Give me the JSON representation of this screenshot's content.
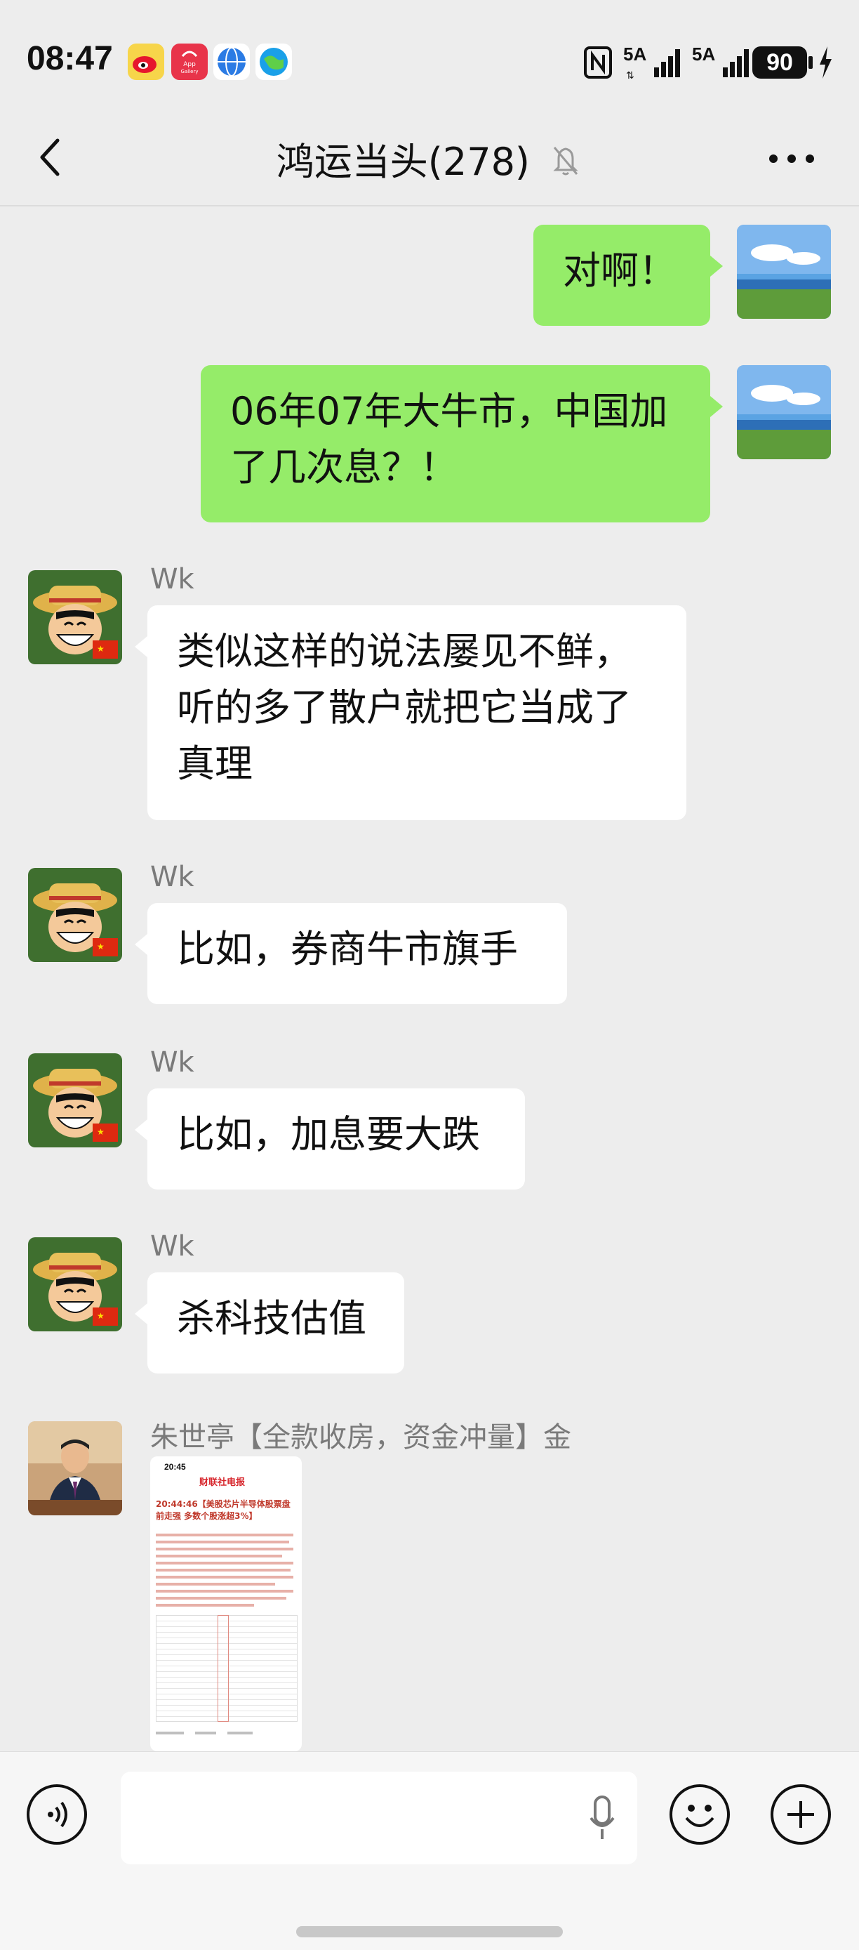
{
  "status_bar": {
    "time": "08:47",
    "signal_1": "5A",
    "signal_2": "5A",
    "battery": "90",
    "app_icons": [
      "weibo-icon",
      "app-gallery-icon",
      "browser-icon",
      "earth-icon"
    ]
  },
  "header": {
    "title": "鸿运当头(278)",
    "back_icon": "chevron-left-icon",
    "mute_icon": "bell-off-icon",
    "more_icon": "more-dots-icon"
  },
  "messages": [
    {
      "side": "me",
      "text": "对啊！"
    },
    {
      "side": "me",
      "text_lines": [
        "06年07年大牛市，中国加",
        "了几次息？！"
      ]
    },
    {
      "side": "other",
      "sender": "Wk",
      "text_lines": [
        "类似这样的说法屡见不鲜，",
        "听的多了散户就把它当成了",
        "真理"
      ]
    },
    {
      "side": "other",
      "sender": "Wk",
      "text": "比如，券商牛市旗手"
    },
    {
      "side": "other",
      "sender": "Wk",
      "text": "比如，加息要大跌"
    },
    {
      "side": "other",
      "sender": "Wk",
      "text": "杀科技估值"
    },
    {
      "side": "other",
      "sender": "朱世亭【全款收房，资金冲量】金",
      "image": {
        "time": "20:45",
        "logo": "财联社电报",
        "headline": "20:44:46【美股芯片半导体股票盘前走强 多数个股涨超3%】"
      }
    }
  ],
  "input_bar": {
    "voice_icon": "voice-icon",
    "mic_icon": "microphone-icon",
    "emoji_icon": "emoji-icon",
    "plus_icon": "plus-icon"
  },
  "colors": {
    "background": "#ededed",
    "my_bubble": "#95ec69",
    "other_bubble": "#ffffff",
    "sender_name": "#7a7a7a"
  }
}
